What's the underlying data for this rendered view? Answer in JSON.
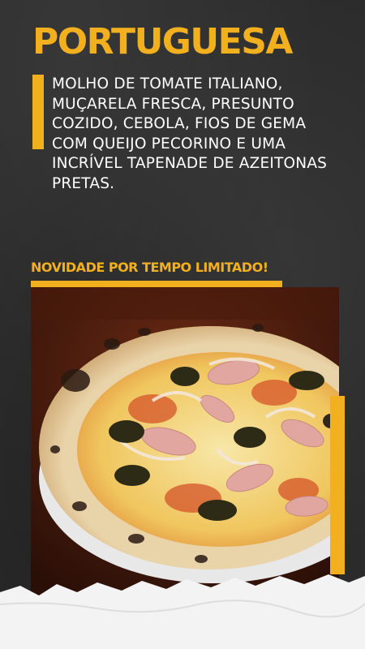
{
  "title": "PORTUGUESA",
  "description": "MOLHO DE TOMATE ITALIANO, MUÇARELA FRESCA, PRESUNTO COZIDO, CEBOLA, FIOS DE GEMA COM QUEIJO PECORINO E UMA INCRÍVEL TAPENADE DE AZEITONAS PRETAS.",
  "badge": "NOVIDADE POR TEMPO LIMITADO!",
  "colors": {
    "accent": "#f2b01e",
    "background": "#2b2b2b",
    "text": "#ffffff"
  }
}
